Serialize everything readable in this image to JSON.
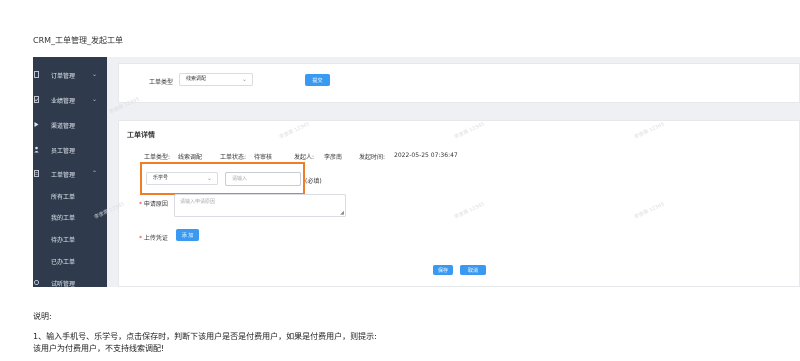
{
  "page_title": "CRM_工单管理_发起工单",
  "sidebar": {
    "items": [
      {
        "label": "订单管理",
        "icon": "document-icon",
        "chevron": "⌄"
      },
      {
        "label": "业绩管理",
        "icon": "check-doc-icon",
        "chevron": "⌄"
      },
      {
        "label": "渠道管理",
        "icon": "channel-icon",
        "chevron": ""
      },
      {
        "label": "员工管理",
        "icon": "person-icon",
        "chevron": ""
      },
      {
        "label": "工单管理",
        "icon": "ticket-icon",
        "chevron": "⌃"
      },
      {
        "label": "试听管理",
        "icon": "headset-icon",
        "chevron": ""
      }
    ],
    "sub_items": [
      "所有工单",
      "我的工单",
      "待办工单",
      "已办工单"
    ]
  },
  "top_panel": {
    "type_label": "工单类型",
    "type_value": "线索调配",
    "confirm_label": "提交"
  },
  "detail": {
    "heading": "工单详情",
    "meta": {
      "type_label": "工单类型:",
      "type_value": "线索调配",
      "status_label": "工单状态:",
      "status_value": "待审核",
      "initiator_label": "发起人:",
      "initiator_value": "李彦南",
      "time_label": "发起时间:",
      "time_value": "2022-05-25 07:36:47"
    },
    "id_select_value": "乐学号",
    "id_input_placeholder": "请输入",
    "required_note": "(必填)",
    "reason_label": "申请原因",
    "reason_placeholder": "请输入申请原因",
    "upload_label": "上传凭证",
    "add_button": "添 加",
    "save_button": "保存",
    "cancel_button": "取消"
  },
  "watermark_text": "李彦南 12345",
  "notes": {
    "heading": "说明:",
    "line1": "1、输入手机号、乐学号，点击保存时，判断下该用户是否是付费用户，如果是付费用户，则提示:",
    "line2": "该用户为付费用户，不支持线索调配!"
  },
  "colors": {
    "sidebar_bg": "#2f3b4c",
    "primary_button": "#3a9af2",
    "highlight_border": "#ef7d27",
    "required_star": "#e53935"
  }
}
